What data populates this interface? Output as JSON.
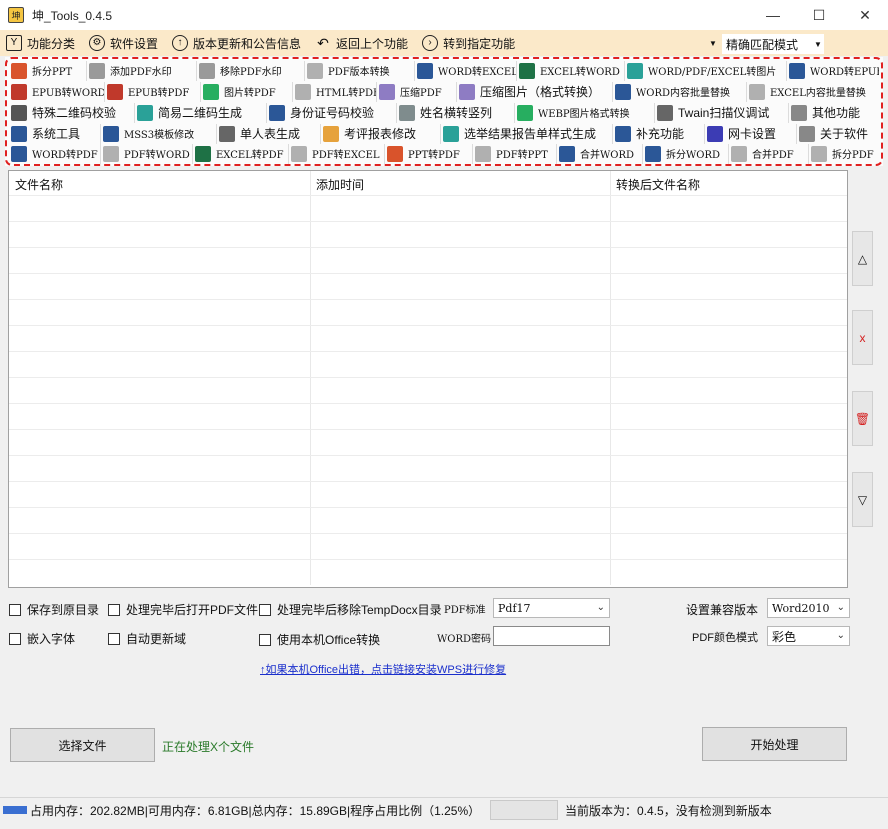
{
  "window": {
    "title": "坤_Tools_0.4.5",
    "minimize": "—",
    "maximize": "☐",
    "close": "✕"
  },
  "menu": {
    "items": [
      {
        "label": "功能分类",
        "icon": "catalog-icon"
      },
      {
        "label": "软件设置",
        "icon": "gear-icon"
      },
      {
        "label": "版本更新和公告信息",
        "icon": "arrow-up-icon"
      },
      {
        "label": "返回上个功能",
        "icon": "back-icon"
      },
      {
        "label": "转到指定功能",
        "icon": "forward-icon"
      }
    ],
    "match_mode": "精确匹配模式"
  },
  "functions": [
    [
      {
        "label": "拆分PPT",
        "icon": "ppt-icon",
        "color": "#d9532b",
        "w": 78
      },
      {
        "label": "添加PDF水印",
        "icon": "watermark-icon",
        "color": "#9a9a9a",
        "w": 110
      },
      {
        "label": "移除PDF水印",
        "icon": "watermark-icon",
        "color": "#9a9a9a",
        "w": 108
      },
      {
        "label": "PDF版本转换",
        "icon": "pdf-icon",
        "color": "#b0b0b0",
        "w": 110
      },
      {
        "label": "WORD转EXCEL",
        "icon": "word-icon",
        "color": "#2b5797",
        "w": 102
      },
      {
        "label": "EXCEL转WORD",
        "icon": "excel-icon",
        "color": "#1e7145",
        "w": 108
      },
      {
        "label": "WORD/PDF/EXCEL转图片",
        "icon": "image-icon",
        "color": "#2aa198",
        "w": 162
      },
      {
        "label": "WORD转EPUB",
        "icon": "word-icon",
        "color": "#2b5797",
        "w": 92
      }
    ],
    [
      {
        "label": "EPUB转WORD",
        "icon": "epub-icon",
        "color": "#c0392b",
        "w": 96
      },
      {
        "label": "EPUB转PDF",
        "icon": "epub-icon",
        "color": "#c0392b",
        "w": 96
      },
      {
        "label": "图片转PDF",
        "icon": "image-icon",
        "color": "#27ae60",
        "w": 92
      },
      {
        "label": "HTML转PDF",
        "icon": "pdf-icon",
        "color": "#b0b0b0",
        "w": 84
      },
      {
        "label": "压缩PDF",
        "icon": "compress-icon",
        "color": "#8e7cc3",
        "w": 80
      },
      {
        "label": "压缩图片（格式转换）",
        "icon": "compress-icon",
        "color": "#8e7cc3",
        "w": 156
      },
      {
        "label": "WORD内容批量替换",
        "icon": "word-icon",
        "color": "#2b5797",
        "w": 134
      },
      {
        "label": "EXCEL内容批量替换",
        "icon": "pdf-icon",
        "color": "#b0b0b0",
        "w": 130
      }
    ],
    [
      {
        "label": "特殊二维码校验",
        "icon": "qrcode-icon",
        "color": "#555555",
        "w": 126
      },
      {
        "label": "简易二维码生成",
        "icon": "qrcode-icon",
        "color": "#2aa198",
        "w": 132
      },
      {
        "label": "身份证号码校验",
        "icon": "id-card-icon",
        "color": "#2b5797",
        "w": 130
      },
      {
        "label": "姓名横转竖列",
        "icon": "name-icon",
        "color": "#7f8c8d",
        "w": 118
      },
      {
        "label": "WEBP图片格式转换",
        "icon": "image-icon",
        "color": "#27ae60",
        "w": 140
      },
      {
        "label": "Twain扫描仪调试",
        "icon": "scanner-icon",
        "color": "#666666",
        "w": 134
      },
      {
        "label": "其他功能",
        "icon": "more-icon",
        "color": "#888888",
        "w": 92
      }
    ],
    [
      {
        "label": "系统工具",
        "icon": "gear-icon",
        "color": "#2b5797",
        "w": 92
      },
      {
        "label": "MSS3模板修改",
        "icon": "gear-icon",
        "color": "#2b5797",
        "w": 116
      },
      {
        "label": "单人表生成",
        "icon": "document-icon",
        "color": "#666666",
        "w": 104
      },
      {
        "label": "考评报表修改",
        "icon": "report-icon",
        "color": "#e6a23c",
        "w": 120
      },
      {
        "label": "选举结果报告单样式生成",
        "icon": "table-icon",
        "color": "#2aa198",
        "w": 172
      },
      {
        "label": "补充功能",
        "icon": "document-icon",
        "color": "#2b5797",
        "w": 92
      },
      {
        "label": "网卡设置",
        "icon": "network-icon",
        "color": "#3c3cb4",
        "w": 92
      },
      {
        "label": "关于软件",
        "icon": "info-icon",
        "color": "#888888",
        "w": 80
      }
    ],
    [
      {
        "label": "WORD转PDF",
        "icon": "word-icon",
        "color": "#2b5797",
        "w": 92
      },
      {
        "label": "PDF转WORD",
        "icon": "pdf-icon",
        "color": "#b0b0b0",
        "w": 92
      },
      {
        "label": "EXCEL转PDF",
        "icon": "excel-icon",
        "color": "#1e7145",
        "w": 96
      },
      {
        "label": "PDF转EXCEL",
        "icon": "pdf-icon",
        "color": "#b0b0b0",
        "w": 96
      },
      {
        "label": "PPT转PDF",
        "icon": "ppt-icon",
        "color": "#d9532b",
        "w": 88
      },
      {
        "label": "PDF转PPT",
        "icon": "pdf-icon",
        "color": "#b0b0b0",
        "w": 84
      },
      {
        "label": "合并WORD",
        "icon": "word-icon",
        "color": "#2b5797",
        "w": 86
      },
      {
        "label": "拆分WORD",
        "icon": "word-icon",
        "color": "#2b5797",
        "w": 86
      },
      {
        "label": "合并PDF",
        "icon": "pdf-icon",
        "color": "#b0b0b0",
        "w": 80
      },
      {
        "label": "拆分PDF",
        "icon": "pdf-icon",
        "color": "#b0b0b0",
        "w": 70
      }
    ]
  ],
  "table": {
    "columns": [
      "文件名称",
      "添加时间",
      "转换后文件名称"
    ]
  },
  "side_buttons": {
    "up": "△",
    "delete": "x",
    "clear": "🗑",
    "down": "▽"
  },
  "options": {
    "save_to_source": "保存到原目录",
    "open_pdf_after": "处理完毕后打开PDF文件",
    "remove_tempdocx": "处理完毕后移除TempDocx目录",
    "pdf_standard_label": "PDF标准",
    "pdf_standard_value": "Pdf17",
    "compat_version_label": "设置兼容版本",
    "compat_version_value": "Word2010",
    "embed_font": "嵌入字体",
    "auto_update_field": "自动更新域",
    "use_local_office": "使用本机Office转换",
    "word_password_label": "WORD密码",
    "word_password_value": "",
    "pdf_color_label": "PDF颜色模式",
    "pdf_color_value": "彩色",
    "repair_link": "↑如果本机Office出错，点击链接安装WPS进行修复"
  },
  "actions": {
    "select_file": "选择文件",
    "processing_text": "正在处理X个文件",
    "start": "开始处理"
  },
  "status": {
    "memory": "占用内存：202.82MB|可用内存：6.81GB|总内存：15.89GB|程序占用比例（1.25%）",
    "version": "当前版本为：0.4.5，没有检测到新版本"
  }
}
